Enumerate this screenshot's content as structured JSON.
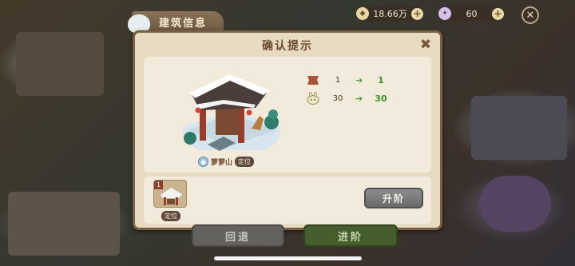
{
  "hud": {
    "tab_label": "建筑信息",
    "coins": "18.66万",
    "gems": "60",
    "coin_icon": "coin-icon",
    "gem_icon": "gem-icon"
  },
  "dialog": {
    "title": "确认提示",
    "location_name": "萝萝山",
    "locate_label": "定位",
    "stats": [
      {
        "icon": "cloth-icon",
        "from": "1",
        "to": "1"
      },
      {
        "icon": "rabbit-icon",
        "from": "30",
        "to": "30"
      }
    ],
    "thumb_level": "1",
    "thumb_locate_label": "定位",
    "upgrade_label": "升阶"
  },
  "footer": {
    "back_label": "回退",
    "advance_label": "进阶"
  },
  "colors": {
    "accent_green": "#3c8b2a",
    "dialog_bg": "#e7dbc2",
    "border_brown": "#7b5f42"
  }
}
